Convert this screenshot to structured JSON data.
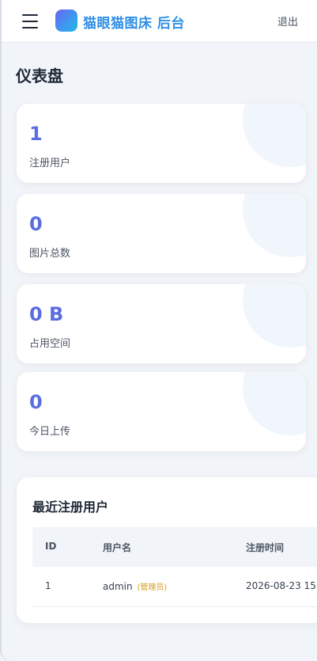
{
  "header": {
    "brand_title": "猫眼猫图床 后台",
    "logout_label": "退出",
    "brand_color": "#2f8fe6",
    "icons": [
      "menu-icon",
      "logo-icon"
    ]
  },
  "dashboard": {
    "title": "仪表盘",
    "accent_color": "#5b6ee1",
    "stats": [
      {
        "value": "1",
        "label": "注册用户"
      },
      {
        "value": "0",
        "label": "图片总数"
      },
      {
        "value": "0 B",
        "label": "占用空间"
      },
      {
        "value": "0",
        "label": "今日上传"
      }
    ]
  },
  "recent_users": {
    "title": "最近注册用户",
    "columns": [
      "ID",
      "用户名",
      "注册时间"
    ],
    "rows": [
      {
        "id": "1",
        "username": "admin",
        "role": "(管理员)",
        "registered_at": "2026-08-23 15:"
      }
    ],
    "role_color": "#d39b1c"
  }
}
